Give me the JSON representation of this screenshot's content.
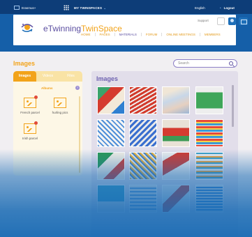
{
  "topbar": {
    "brand": "Erasmus+",
    "my_twinspaces": "MY TWINSPACES",
    "language": "English",
    "logout": "Logout"
  },
  "header": {
    "logo_part1": "eTwinning",
    "logo_part2": "TwinSpace",
    "support": "Support",
    "nav": [
      "HOME",
      "PAGES",
      "MATERIALS",
      "FORUM",
      "ONLINE MEETINGS",
      "MEMBERS"
    ],
    "active_nav": "MATERIALS"
  },
  "page": {
    "section_title": "Images",
    "search_placeholder": "Search"
  },
  "sidebar": {
    "tabs": [
      "Images",
      "Videos",
      "Files"
    ],
    "active_tab": "Images",
    "albums_heading": "Albums",
    "help": "?",
    "albums": [
      {
        "label": "French parcel"
      },
      {
        "label": "hurling pics"
      },
      {
        "label": "Irish parcel"
      }
    ]
  },
  "images_panel": {
    "title": "Images",
    "thumbnail_count": 16
  },
  "colors": {
    "accent_orange": "#f2a31a",
    "accent_purple": "#6e62b0",
    "navy": "#0d3d78",
    "blue": "#1769b3"
  }
}
